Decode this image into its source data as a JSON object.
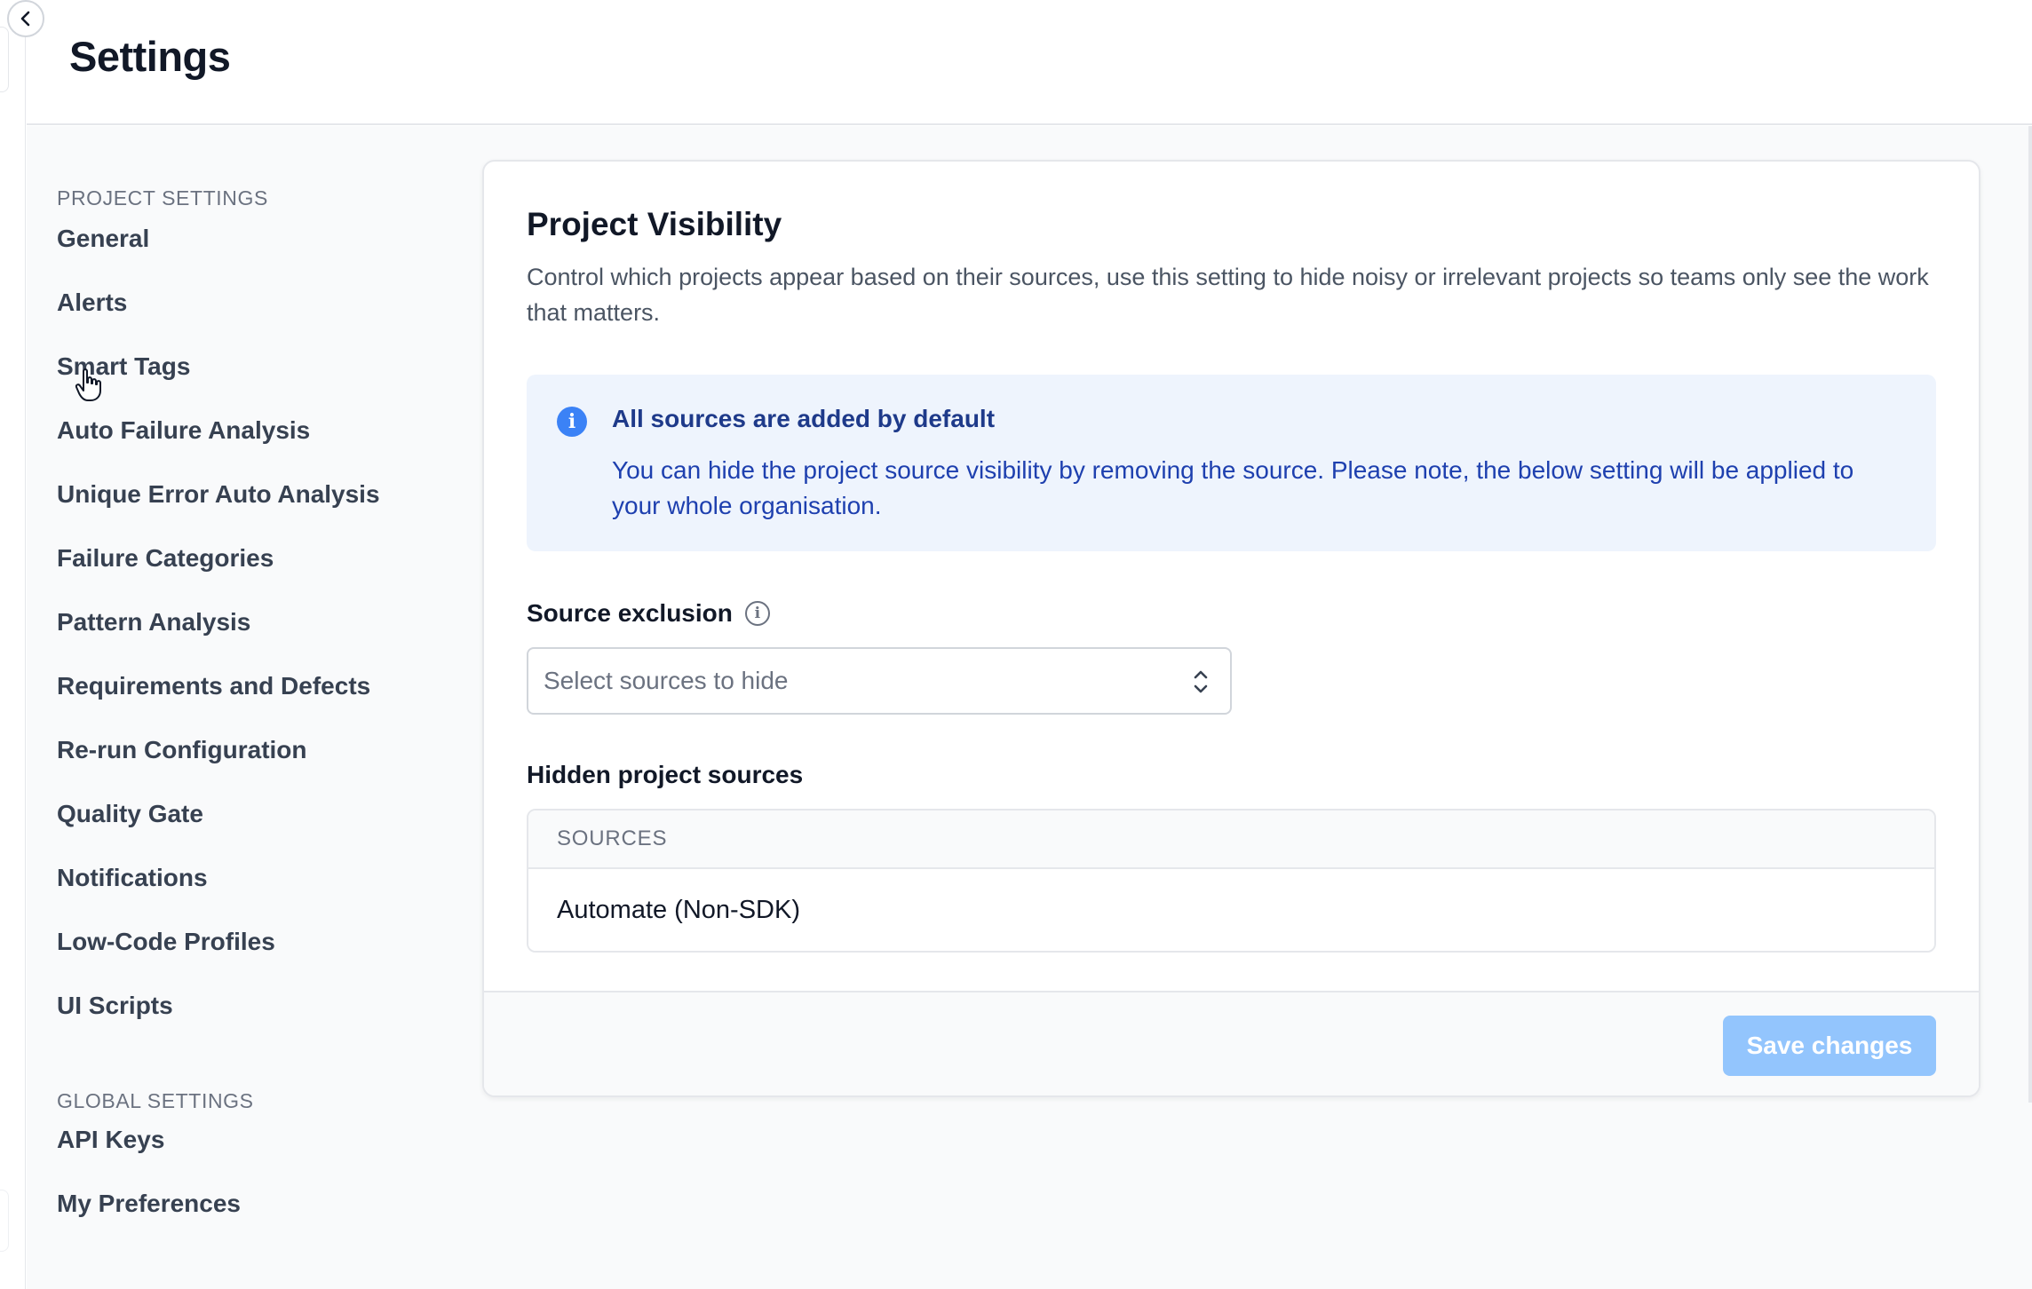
{
  "header": {
    "title": "Settings"
  },
  "sidebar": {
    "project_heading": "PROJECT SETTINGS",
    "project_items": [
      {
        "label": "General"
      },
      {
        "label": "Alerts"
      },
      {
        "label": "Smart Tags"
      },
      {
        "label": "Auto Failure Analysis"
      },
      {
        "label": "Unique Error Auto Analysis"
      },
      {
        "label": "Failure Categories"
      },
      {
        "label": "Pattern Analysis"
      },
      {
        "label": "Requirements and Defects"
      },
      {
        "label": "Re-run Configuration"
      },
      {
        "label": "Quality Gate"
      },
      {
        "label": "Notifications"
      },
      {
        "label": "Low-Code Profiles"
      },
      {
        "label": "UI Scripts"
      }
    ],
    "global_heading": "GLOBAL SETTINGS",
    "global_items": [
      {
        "label": "API Keys"
      },
      {
        "label": "My Preferences"
      }
    ]
  },
  "card": {
    "title": "Project Visibility",
    "description": "Control which projects appear based on their sources, use this setting to hide noisy or irrelevant projects so teams only see the work that matters.",
    "info": {
      "icon": "info-icon",
      "title": "All sources are added by default",
      "text": "You can hide the project source visibility by removing the source. Please note, the below setting will be applied to your whole organisation."
    },
    "source_exclusion": {
      "label": "Source exclusion",
      "placeholder": "Select sources to hide"
    },
    "hidden_sources": {
      "label": "Hidden project sources",
      "column": "SOURCES",
      "rows": [
        "Automate (Non-SDK)"
      ]
    },
    "save_label": "Save changes"
  },
  "colors": {
    "accent": "#3b82f6",
    "info_bg": "#eef4fd",
    "save_disabled": "#93c5fd"
  }
}
